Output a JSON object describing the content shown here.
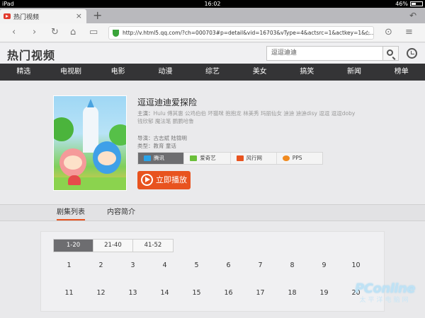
{
  "status_bar": {
    "device": "iPad",
    "time": "16:02",
    "battery": "46%",
    "battery_level": 0.46
  },
  "browser": {
    "tab_title": "热门视频",
    "url": "http://v.html5.qq.com/?ch=000703#p=detail&vid=16703&vType=4&actsrc=1&actkey=1&c..."
  },
  "site": {
    "logo": "热门视频",
    "search_value": "逗逗迪迪"
  },
  "categories": [
    "精选",
    "电视剧",
    "电影",
    "动漫",
    "综艺",
    "美女",
    "搞笑",
    "新闻",
    "榜单"
  ],
  "show": {
    "title": "逗逗迪迪爱探险",
    "cast_label": "主演：",
    "cast_line1": "Hulu 傅其惠 公鸡伯伯 坏猫咪 抱抱龙 林美秀 玛丽仙女 迪迪 迪迪disy 逗逗 逗逗doby",
    "cast_line2": "钱欣郁 魔法笔 鹏鹏哈鲁",
    "director_label": "导演：",
    "director": "古志斌 陆锦明",
    "genre_label": "类型：",
    "genre": "教育 童话"
  },
  "sources": [
    {
      "label": "腾讯",
      "color": "#2aa3e8"
    },
    {
      "label": "爱奇艺",
      "color": "#6bbf3a"
    },
    {
      "label": "风行网",
      "color": "#e8531f"
    },
    {
      "label": "PPS",
      "color": "#f08a1f"
    }
  ],
  "play_label": "立即播放",
  "section_tabs": [
    "剧集列表",
    "内容简介"
  ],
  "episode_ranges": [
    "1-20",
    "21-40",
    "41-52"
  ],
  "episodes_row1": [
    "1",
    "2",
    "3",
    "4",
    "5",
    "6",
    "7",
    "8",
    "9",
    "10"
  ],
  "episodes_row2": [
    "11",
    "12",
    "13",
    "14",
    "15",
    "16",
    "17",
    "18",
    "19",
    "20"
  ],
  "watermark": {
    "main": "PConline",
    "sub": "太平洋电脑网"
  }
}
